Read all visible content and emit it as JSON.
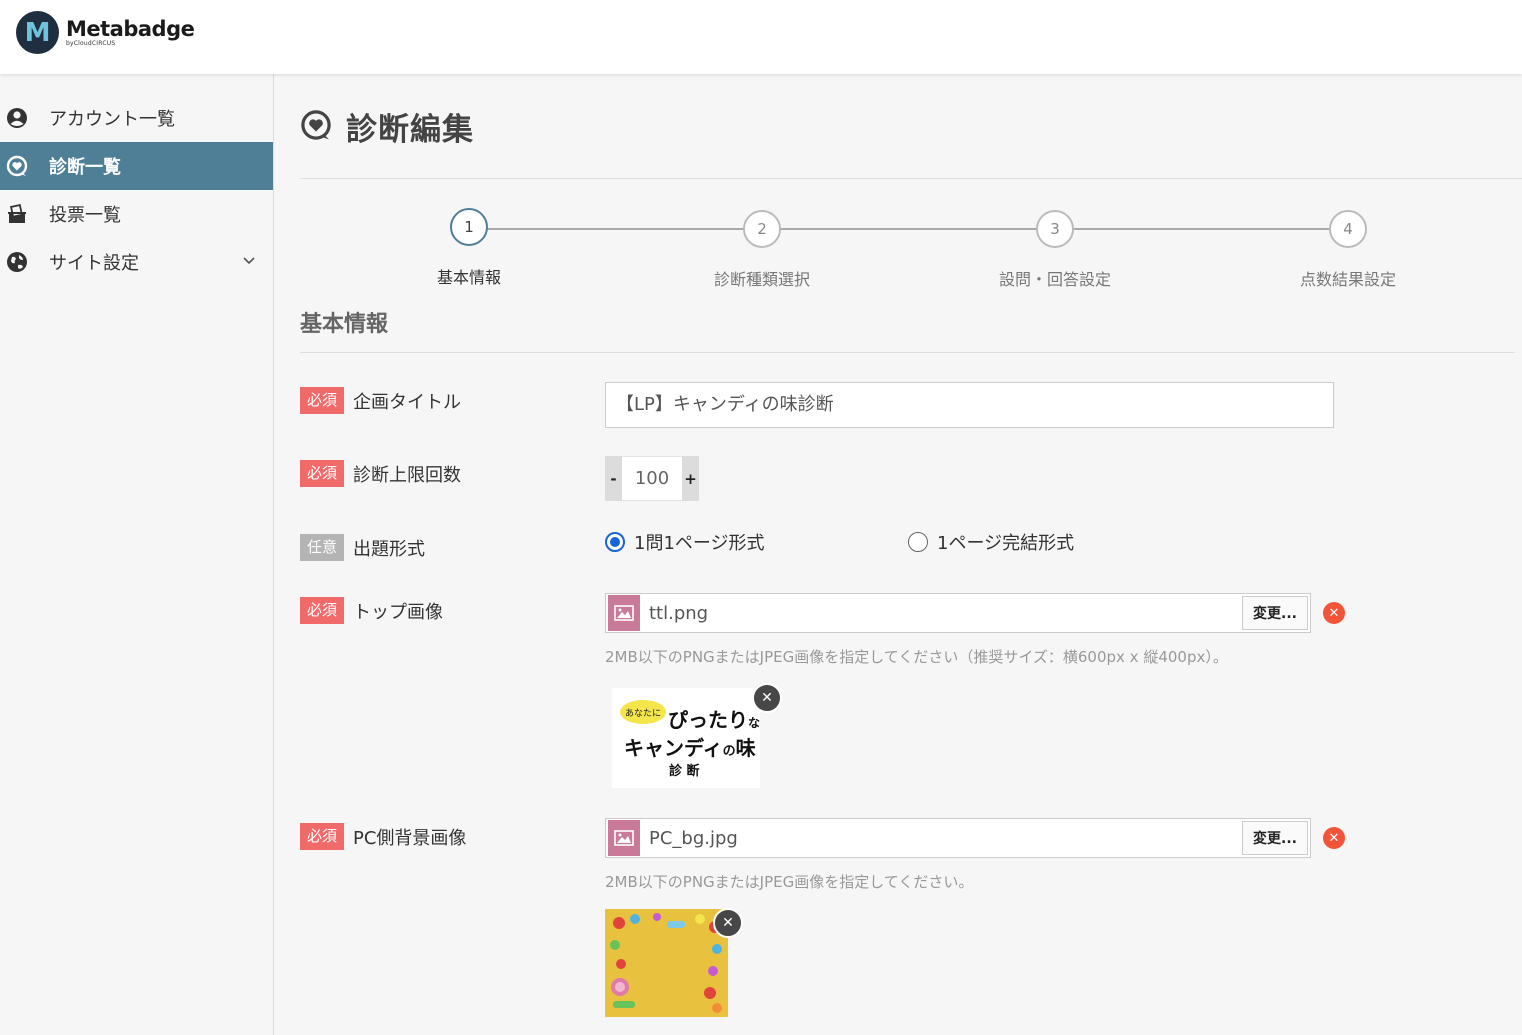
{
  "brand": {
    "mark": "M",
    "name": "Metabadge",
    "sub": "byCloudCIRCUS"
  },
  "sidebar": {
    "items": [
      {
        "label": "アカウント一覧",
        "icon": "user-circle-icon"
      },
      {
        "label": "診断一覧",
        "icon": "heart-chat-icon",
        "active": true
      },
      {
        "label": "投票一覧",
        "icon": "ballot-box-icon"
      },
      {
        "label": "サイト設定",
        "icon": "globe-icon",
        "expandable": true
      }
    ]
  },
  "page": {
    "title": "診断編集",
    "icon": "heart-chat-icon"
  },
  "steps": [
    {
      "number": "1",
      "label": "基本情報",
      "active": true
    },
    {
      "number": "2",
      "label": "診断種類選択"
    },
    {
      "number": "3",
      "label": "設問・回答設定"
    },
    {
      "number": "4",
      "label": "点数結果設定"
    }
  ],
  "section": {
    "title": "基本情報"
  },
  "badges": {
    "required": "必須",
    "optional": "任意"
  },
  "form": {
    "title_field": {
      "label": "企画タイトル",
      "value": "【LP】キャンディの味診断"
    },
    "limit_field": {
      "label": "診断上限回数",
      "value": "100",
      "minus": "-",
      "plus": "+"
    },
    "format_field": {
      "label": "出題形式",
      "options": [
        {
          "label": "1問1ページ形式",
          "checked": true
        },
        {
          "label": "1ページ完結形式",
          "checked": false
        }
      ]
    },
    "top_image": {
      "label": "トップ画像",
      "filename": "ttl.png",
      "change_label": "変更...",
      "hint": "2MB以下のPNGまたはJPEG画像を指定してください（推奨サイズ：横600px x 縦400px）。",
      "preview": {
        "bubble": "あなたに",
        "line1": "ぴったり",
        "line1_small": "な",
        "line2": "キャンディ",
        "line2_small": "の",
        "line2_end": "味",
        "line3": "診 断"
      }
    },
    "pc_bg_image": {
      "label": "PC側背景画像",
      "filename": "PC_bg.jpg",
      "change_label": "変更...",
      "hint": "2MB以下のPNGまたはJPEG画像を指定してください。"
    }
  },
  "colors": {
    "sidebar_active": "#4f7f96",
    "required_badge": "#f06a6a",
    "optional_badge": "#b4b4b4",
    "radio_checked": "#1565d8",
    "remove": "#f2543a"
  }
}
